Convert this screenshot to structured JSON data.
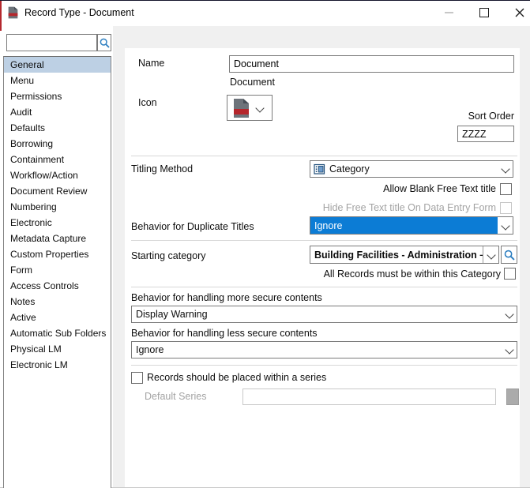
{
  "window": {
    "title": "Record Type - Document",
    "controls": {
      "minimize": "minimize",
      "maximize": "maximize",
      "close": "close"
    },
    "accent_red": "#b4282e"
  },
  "sidebar": {
    "search_value": "",
    "items": [
      {
        "label": "General",
        "selected": true
      },
      {
        "label": "Menu",
        "selected": false
      },
      {
        "label": "Permissions",
        "selected": false
      },
      {
        "label": "Audit",
        "selected": false
      },
      {
        "label": "Defaults",
        "selected": false
      },
      {
        "label": "Borrowing",
        "selected": false
      },
      {
        "label": "Containment",
        "selected": false
      },
      {
        "label": "Workflow/Action",
        "selected": false
      },
      {
        "label": "Document Review",
        "selected": false
      },
      {
        "label": "Numbering",
        "selected": false
      },
      {
        "label": "Electronic",
        "selected": false
      },
      {
        "label": "Metadata Capture",
        "selected": false
      },
      {
        "label": "Custom Properties",
        "selected": false
      },
      {
        "label": "Form",
        "selected": false
      },
      {
        "label": "Access Controls",
        "selected": false
      },
      {
        "label": "Notes",
        "selected": false
      },
      {
        "label": "Active",
        "selected": false
      },
      {
        "label": "Automatic Sub Folders",
        "selected": false
      },
      {
        "label": "Physical LM",
        "selected": false
      },
      {
        "label": "Electronic LM",
        "selected": false
      }
    ]
  },
  "form": {
    "name_label": "Name",
    "name_value": "Document",
    "name_caption": "Document",
    "icon_label": "Icon",
    "sort_order_label": "Sort Order",
    "sort_order_value": "ZZZZ",
    "titling_method_label": "Titling Method",
    "titling_method_value": "Category",
    "allow_blank_label": "Allow Blank Free Text title",
    "allow_blank_checked": false,
    "hide_free_text_label": "Hide Free Text title On Data Entry Form",
    "hide_free_text_checked": false,
    "hide_free_text_enabled": false,
    "duplicate_titles_label": "Behavior for Duplicate Titles",
    "duplicate_titles_value": "Ignore",
    "starting_category_label": "Starting category",
    "starting_category_value": "Building Facilities - Administration – Asse",
    "all_records_label": "All Records must be within this Category",
    "all_records_checked": false,
    "more_secure_label": "Behavior for handling more secure contents",
    "more_secure_value": "Display Warning",
    "less_secure_label": "Behavior for handling less secure contents",
    "less_secure_value": "Ignore",
    "series_checkbox_label": "Records should be placed within a series",
    "series_checked": false,
    "default_series_label": "Default Series",
    "default_series_value": "",
    "default_series_enabled": false
  },
  "colors": {
    "selection_blue": "#0c7cd5",
    "list_selected_bg": "#bdd0e4",
    "icon_red": "#b5262c",
    "icon_gray": "#6d737a"
  }
}
